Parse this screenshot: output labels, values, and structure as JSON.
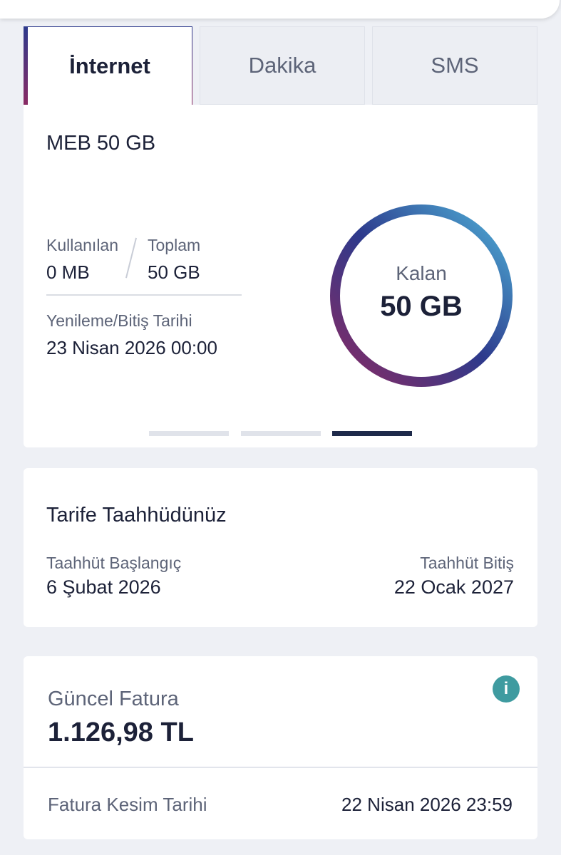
{
  "tabs": [
    {
      "label": "İnternet",
      "active": true
    },
    {
      "label": "Dakika",
      "active": false
    },
    {
      "label": "SMS",
      "active": false
    }
  ],
  "usage": {
    "package_name": "MEB 50 GB",
    "used_label": "Kullanılan",
    "used_value": "0 MB",
    "total_label": "Toplam",
    "total_value": "50 GB",
    "renewal_label": "Yenileme/Bitiş Tarihi",
    "renewal_value": "23 Nisan 2026 00:00",
    "remaining_label": "Kalan",
    "remaining_value": "50 GB",
    "remaining_fraction": 1.0,
    "pager": {
      "count": 3,
      "active_index": 2
    }
  },
  "commitment": {
    "title": "Tarife Taahhüdünüz",
    "start_label": "Taahhüt Başlangıç",
    "start_value": "6 Şubat 2026",
    "end_label": "Taahhüt Bitiş",
    "end_value": "22 Ocak 2027"
  },
  "invoice": {
    "label": "Güncel Fatura",
    "amount": "1.126,98 TL",
    "info_icon": "i",
    "cut_label": "Fatura Kesim Tarihi",
    "cut_value": "22 Nisan 2026 23:59"
  },
  "colors": {
    "ring_start": "#8a2a63",
    "ring_mid": "#2d3a8c",
    "ring_end": "#4fb3d9",
    "info": "#3f9ba0",
    "pager_active": "#1e2a4a"
  }
}
